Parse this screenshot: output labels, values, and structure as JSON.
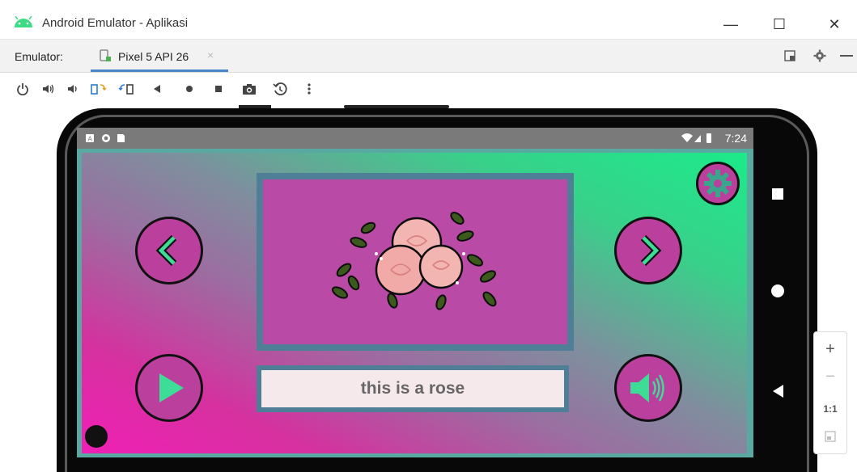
{
  "window": {
    "title": "Android Emulator - Aplikasi",
    "minimize": "—",
    "maximize": "☐",
    "close": "✕"
  },
  "tabbar": {
    "label": "Emulator:",
    "tab_name": "Pixel 5 API 26",
    "tab_close": "×"
  },
  "toolbar": {
    "icons": [
      "power-icon",
      "volume-up-icon",
      "volume-down-icon",
      "rotate-left-icon",
      "rotate-right-icon",
      "back-icon",
      "home-icon",
      "overview-icon",
      "screenshot-icon",
      "snapshot-icon",
      "more-icon"
    ]
  },
  "device": {
    "status_time": "7:24"
  },
  "app": {
    "caption": "this is a rose"
  },
  "zoom": {
    "plus": "+",
    "minus": "−",
    "ratio": "1:1"
  },
  "colors": {
    "accent_tab": "#4a86c7",
    "button_fill": "#bb3f9c",
    "arrow_green": "#3ddc97",
    "frame_teal": "#5aa8a2"
  }
}
